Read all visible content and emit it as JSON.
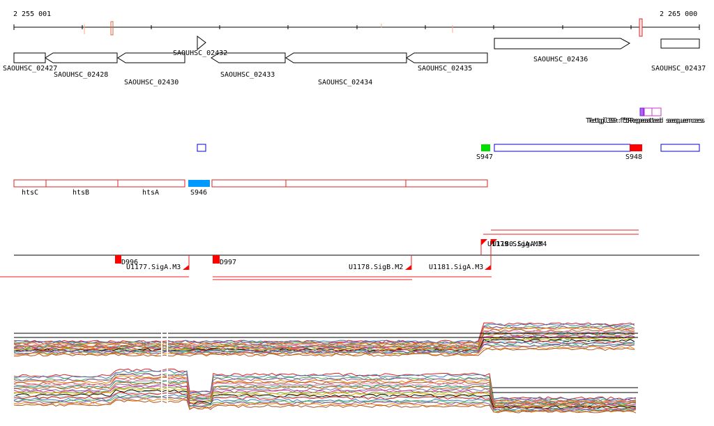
{
  "ruler": {
    "left_label": "2 255 001",
    "right_label": "2 265 000"
  },
  "genes": [
    {
      "id": "SAOUHSC_02427",
      "label": "SAOUHSC_02427"
    },
    {
      "id": "SAOUHSC_02428",
      "label": "SAOUHSC_02428"
    },
    {
      "id": "SAOUHSC_02430",
      "label": "SAOUHSC_02430"
    },
    {
      "id": "SAOUHSC_02432",
      "label": "SAOUHSC_02432"
    },
    {
      "id": "SAOUHSC_02433",
      "label": "SAOUHSC_02433"
    },
    {
      "id": "SAOUHSC_02434",
      "label": "SAOUHSC_02434"
    },
    {
      "id": "SAOUHSC_02435",
      "label": "SAOUHSC_02435"
    },
    {
      "id": "SAOUHSC_02436",
      "label": "SAOUHSC_02436"
    },
    {
      "id": "SAOUHSC_02437",
      "label": "SAOUHSC_02437"
    }
  ],
  "repeats": {
    "label_1": "Tetgl39:f5Repeated sequences",
    "label_2": "Tetgl39:f5Repeated sequences"
  },
  "s_features": {
    "s947": "S947",
    "s948": "S948",
    "s946": "S946"
  },
  "operon_genes": {
    "htsC": "htsC",
    "htsB": "htsB",
    "htsA": "htsA"
  },
  "promoters": {
    "d996": "D996",
    "d997": "D997",
    "u1177": "U1177.SigA.M3",
    "u1178": "U1178.SigB.M2",
    "u1181": "U1181.SigA.M3",
    "u1179": "U1179.SigA.M3",
    "u1180": "U1180.SigA.M4"
  },
  "colors": {
    "gene_outline": "#000000",
    "red": "#ff0000",
    "blue": "#0000cc",
    "green": "#00dd00",
    "light_blue": "#0099ff",
    "purple": "#9933ff",
    "pink": "#cc33cc"
  }
}
